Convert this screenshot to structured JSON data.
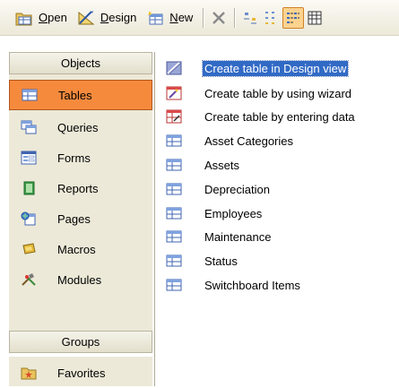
{
  "toolbar": {
    "open_label": "Open",
    "design_label": "Design",
    "new_label": "New"
  },
  "objects_bar": {
    "header": "Objects",
    "items": [
      {
        "label": "Tables",
        "icon": "table-icon",
        "selected": true
      },
      {
        "label": "Queries",
        "icon": "query-icon",
        "selected": false
      },
      {
        "label": "Forms",
        "icon": "form-icon",
        "selected": false
      },
      {
        "label": "Reports",
        "icon": "report-icon",
        "selected": false
      },
      {
        "label": "Pages",
        "icon": "page-icon",
        "selected": false
      },
      {
        "label": "Macros",
        "icon": "macro-icon",
        "selected": false
      },
      {
        "label": "Modules",
        "icon": "module-icon",
        "selected": false
      }
    ],
    "groups_header": "Groups",
    "favorites_label": "Favorites"
  },
  "list": {
    "items": [
      {
        "label": "Create table in Design view",
        "icon": "design-view-icon",
        "focused": true
      },
      {
        "label": "Create table by using wizard",
        "icon": "wizard-icon",
        "focused": false
      },
      {
        "label": "Create table by entering data",
        "icon": "datasheet-icon",
        "focused": false
      },
      {
        "label": "Asset Categories",
        "icon": "table-icon",
        "focused": false
      },
      {
        "label": "Assets",
        "icon": "table-icon",
        "focused": false
      },
      {
        "label": "Depreciation",
        "icon": "table-icon",
        "focused": false
      },
      {
        "label": "Employees",
        "icon": "table-icon",
        "focused": false
      },
      {
        "label": "Maintenance",
        "icon": "table-icon",
        "focused": false
      },
      {
        "label": "Status",
        "icon": "table-icon",
        "focused": false
      },
      {
        "label": "Switchboard Items",
        "icon": "table-icon",
        "focused": false
      }
    ]
  },
  "colors": {
    "selected_object": "#f58a3d",
    "focus_highlight": "#316ac5",
    "panel_bg": "#ece9d8"
  }
}
